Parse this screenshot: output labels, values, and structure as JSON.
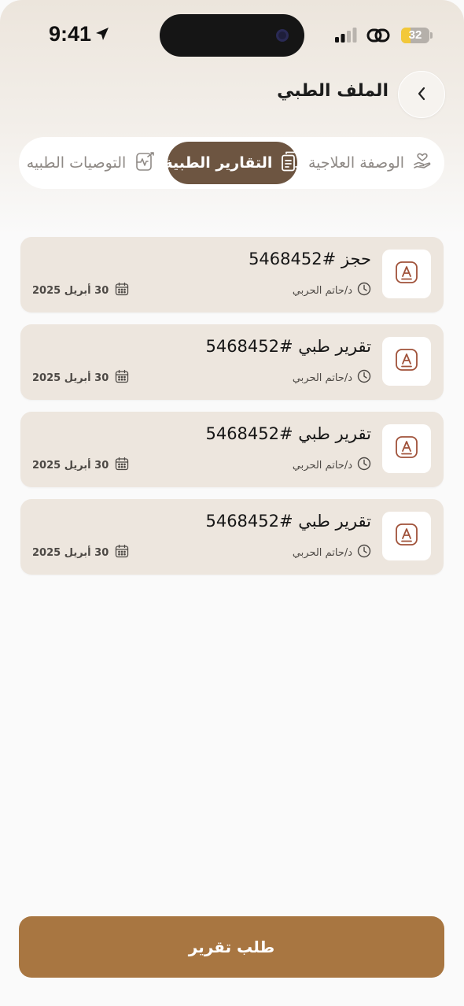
{
  "status_bar": {
    "time": "9:41",
    "battery": "32",
    "battery_level_percent": 32
  },
  "header": {
    "title": "الملف الطبي",
    "back_icon": "chevron-left-icon"
  },
  "tabs": [
    {
      "label": "الوصفة العلاجية",
      "icon": "hand-heart-icon",
      "active": false
    },
    {
      "label": "التقارير الطبية",
      "icon": "document-icon",
      "active": true
    },
    {
      "label": "التوصيات الطبيه",
      "icon": "clipboard-pulse-icon",
      "active": false
    }
  ],
  "reports": [
    {
      "title": "حجز #5468452",
      "doctor": "د/حاتم الحربي",
      "date": "30 أبريل 2025"
    },
    {
      "title": "تقرير طبي #5468452",
      "doctor": "د/حاتم الحربي",
      "date": "30 أبريل 2025"
    },
    {
      "title": "تقرير طبي #5468452",
      "doctor": "د/حاتم الحربي",
      "date": "30 أبريل 2025"
    },
    {
      "title": "تقرير طبي #5468452",
      "doctor": "د/حاتم الحربي",
      "date": "30 أبريل 2025"
    }
  ],
  "request_button": {
    "label": "طلب تقرير"
  },
  "colors": {
    "accent": "#a87641",
    "active_tab": "#6d5541",
    "card_bg": "#ede6de",
    "icon_accent": "#a0523a"
  }
}
